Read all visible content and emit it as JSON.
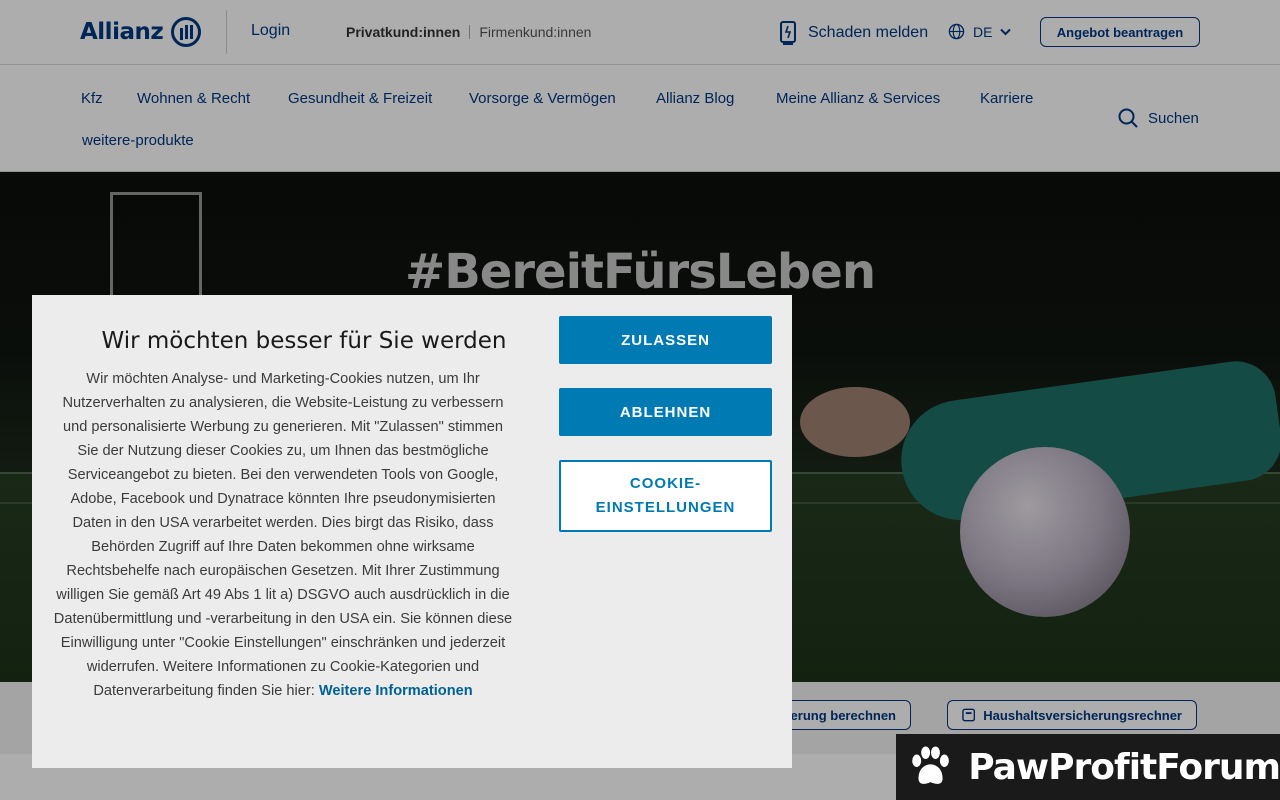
{
  "header": {
    "brand": "Allianz",
    "login": "Login",
    "segment_active": "Privatkund:innen",
    "segment_inactive": "Firmenkund:innen",
    "claim": "Schaden melden",
    "language": "DE",
    "offer_button": "Angebot beantragen"
  },
  "nav": {
    "items": [
      "Kfz",
      "Wohnen & Recht",
      "Gesundheit & Freizeit",
      "Vorsorge & Vermögen",
      "Allianz Blog",
      "Meine Allianz & Services",
      "Karriere",
      "weitere-produkte"
    ],
    "search": "Suchen"
  },
  "hero": {
    "title": "#BereitFürsLeben"
  },
  "calculators": {
    "first": "erung berechnen",
    "second": "Haushaltsversicherungsrechner"
  },
  "cookie_modal": {
    "title": "Wir möchten besser für Sie werden",
    "body": "Wir möchten Analyse- und Marketing-Cookies nutzen, um Ihr Nutzerverhalten zu analysieren, die Website-Leistung zu verbessern und personalisierte Werbung zu generieren. Mit \"Zulassen\" stimmen Sie der Nutzung dieser Cookies zu, um Ihnen das bestmögliche Serviceangebot zu bieten. Bei den verwendeten Tools von Google, Adobe, Facebook und Dynatrace könnten Ihre pseudonymisierten Daten in den USA verarbeitet werden. Dies birgt das Risiko, dass Behörden Zugriff auf Ihre Daten bekommen ohne wirksame Rechtsbehelfe nach europäischen Gesetzen. Mit Ihrer Zustimmung willigen Sie gemäß Art 49 Abs 1 lit a) DSGVO auch ausdrücklich in die Datenübermittlung und -verarbeitung in den USA ein. Sie können diese Einwilligung unter \"Cookie Einstellungen\" einschränken und jederzeit widerrufen. Weitere Informationen zu Cookie-Kategorien und Datenverarbeitung finden Sie hier:",
    "link": "Weitere Informationen",
    "accept": "ZULASSEN",
    "decline": "ABLEHNEN",
    "settings": "COOKIE-EINSTELLUNGEN"
  },
  "watermark": {
    "text": "PawProfitForum"
  },
  "colors": {
    "brand_blue": "#003781",
    "button_blue": "#007ab3",
    "link_blue": "#006192"
  }
}
